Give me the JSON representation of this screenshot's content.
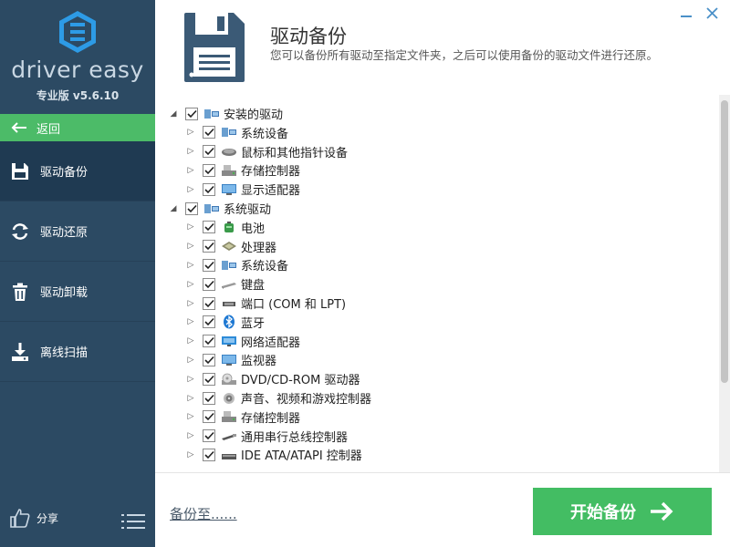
{
  "app": {
    "brand": "driver easy",
    "version": "专业版 v5.6.10"
  },
  "sidebar": {
    "back_label": "返回",
    "items": [
      {
        "label": "驱动备份",
        "icon": "floppy-disk-icon",
        "active": true
      },
      {
        "label": "驱动还原",
        "icon": "refresh-icon",
        "active": false
      },
      {
        "label": "驱动卸载",
        "icon": "trash-icon",
        "active": false
      },
      {
        "label": "离线扫描",
        "icon": "download-scan-icon",
        "active": false
      }
    ],
    "share_label": "分享"
  },
  "header": {
    "title": "驱动备份",
    "subtitle": "您可以备份所有驱动至指定文件夹，之后可以使用备份的驱动文件进行还原。"
  },
  "tree": {
    "rows": [
      {
        "level": 0,
        "label": "安装的驱动",
        "expanded": true,
        "icon": "system-icon"
      },
      {
        "level": 1,
        "label": "系统设备",
        "expanded": false,
        "icon": "system-icon"
      },
      {
        "level": 1,
        "label": "鼠标和其他指针设备",
        "expanded": false,
        "icon": "mouse-icon"
      },
      {
        "level": 1,
        "label": "存储控制器",
        "expanded": false,
        "icon": "storage-icon"
      },
      {
        "level": 1,
        "label": "显示适配器",
        "expanded": false,
        "icon": "monitor-icon"
      },
      {
        "level": 0,
        "label": "系统驱动",
        "expanded": true,
        "icon": "system-icon"
      },
      {
        "level": 1,
        "label": "电池",
        "expanded": false,
        "icon": "battery-icon"
      },
      {
        "level": 1,
        "label": "处理器",
        "expanded": false,
        "icon": "cpu-icon"
      },
      {
        "level": 1,
        "label": "系统设备",
        "expanded": false,
        "icon": "system-icon"
      },
      {
        "level": 1,
        "label": "键盘",
        "expanded": false,
        "icon": "keyboard-icon"
      },
      {
        "level": 1,
        "label": "端口 (COM 和 LPT)",
        "expanded": false,
        "icon": "port-icon"
      },
      {
        "level": 1,
        "label": "蓝牙",
        "expanded": false,
        "icon": "bluetooth-icon"
      },
      {
        "level": 1,
        "label": "网络适配器",
        "expanded": false,
        "icon": "network-icon"
      },
      {
        "level": 1,
        "label": "监视器",
        "expanded": false,
        "icon": "monitor-icon"
      },
      {
        "level": 1,
        "label": "DVD/CD-ROM 驱动器",
        "expanded": false,
        "icon": "dvd-icon"
      },
      {
        "level": 1,
        "label": "声音、视频和游戏控制器",
        "expanded": false,
        "icon": "speaker-icon"
      },
      {
        "level": 1,
        "label": "存储控制器",
        "expanded": false,
        "icon": "storage-icon"
      },
      {
        "level": 1,
        "label": "通用串行总线控制器",
        "expanded": false,
        "icon": "usb-icon"
      },
      {
        "level": 1,
        "label": "IDE ATA/ATAPI 控制器",
        "expanded": false,
        "icon": "ide-icon"
      }
    ]
  },
  "footer": {
    "backup_to_label": "备份至......",
    "start_label": "开始备份"
  },
  "colors": {
    "sidebar_bg": "#2c4a63",
    "active_bg": "#1f3a52",
    "accent_green": "#43bd63",
    "tree_bg": "#ffffff"
  }
}
